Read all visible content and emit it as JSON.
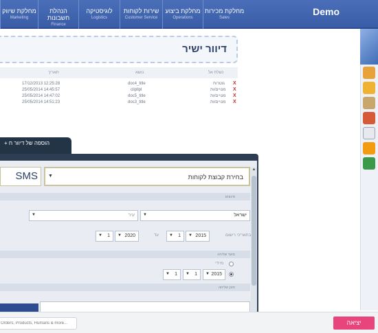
{
  "app": {
    "brand": "Demo"
  },
  "nav": {
    "tabs": [
      {
        "label": "מחלקת מכירות",
        "sub": "Sales"
      },
      {
        "label": "מחלקת ביצוע",
        "sub": "Operations"
      },
      {
        "label": "שירות לקוחות",
        "sub": "Customer Service"
      },
      {
        "label": "לוגיסטיקה",
        "sub": "Logistics"
      },
      {
        "label": "הנהלת חשבונות",
        "sub": "Finance"
      },
      {
        "label": "מחלקת שיווק",
        "sub": "Marketing"
      }
    ]
  },
  "page": {
    "title": "דיוור ישיר"
  },
  "table": {
    "headers": [
      "נשלח אל",
      "נושא",
      "תאריך"
    ],
    "rows": [
      {
        "to": "גוטרות",
        "subject": "doc4_title",
        "date": "17/12/2013 12:25:28"
      },
      {
        "to": "מנויים/ות",
        "subject": "clipllpl",
        "date": "25/05/2014 14:45:57"
      },
      {
        "to": "מנויים/ות",
        "subject": "doc5_title",
        "date": "25/05/2014 14:47:02"
      },
      {
        "to": "מנויים/ות",
        "subject": "doc3_title",
        "date": "25/05/2014 14:51:23"
      }
    ],
    "delete_symbol": "X"
  },
  "add_tab": {
    "label": "+ הוספה של דיוור ח"
  },
  "dialog": {
    "sms_label": "SMS",
    "group_select": "בחירת קבוצת לקוחות",
    "section_filters": "סינונים",
    "country_value": "ישראל",
    "city_placeholder": "עיר",
    "date_range_label": "בתאריכי רישום",
    "date_from": {
      "year": "2015",
      "month": "1",
      "day": "1"
    },
    "date_to_label": "עד",
    "date_to": {
      "year": "2020",
      "month": "1",
      "day": "1"
    },
    "section_send_time": "מועד שליחה",
    "radio_now_label": "מיידי",
    "send_date": {
      "year": "2015",
      "month": "1",
      "day": "1"
    },
    "section_content": "תוכן שליחה",
    "scroll_up_glyph": "▲",
    "scroll_down_glyph": "▼",
    "select_arrow_glyph": "▼"
  },
  "bottom": {
    "search_placeholder": "Orders, Products, Humans & more...",
    "exit_label": "יציאה"
  },
  "colors": {
    "nav": "#3a5ca6",
    "dialog": "#2d3e52",
    "exit": "#e8457d",
    "delete": "#c62828"
  }
}
